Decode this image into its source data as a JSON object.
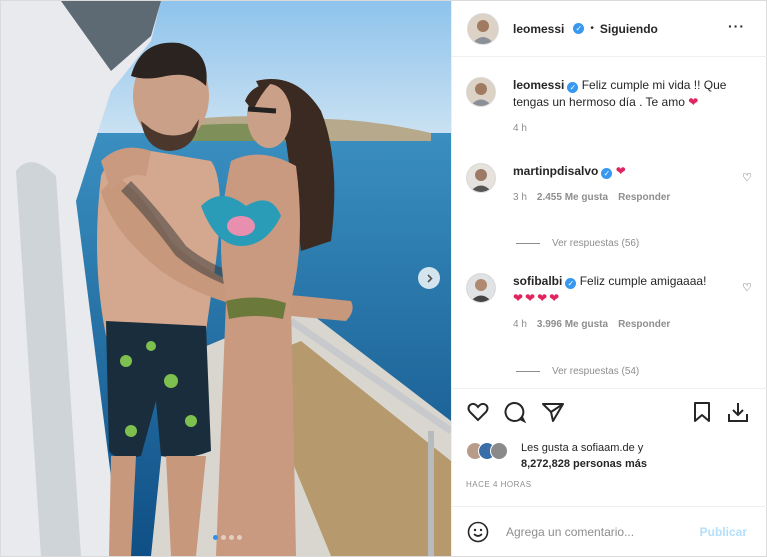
{
  "header": {
    "username": "leomessi",
    "separator": "•",
    "follow_label": "Siguiendo",
    "more_label": "···"
  },
  "caption": {
    "username": "leomessi",
    "text": "Feliz cumple mi vida !! Que tengas un hermoso día . Te amo",
    "emoji": "❤",
    "time": "4 h"
  },
  "comments": [
    {
      "username": "martinpdisalvo",
      "text": "",
      "emoji": "❤",
      "time": "3 h",
      "likes": "2.455 Me gusta",
      "reply_label": "Responder",
      "view_replies": "Ver respuestas (56)"
    },
    {
      "username": "sofibalbi",
      "text": "Feliz cumple amigaaaa!",
      "emoji": "❤❤❤❤",
      "time": "4 h",
      "likes": "3.996 Me gusta",
      "reply_label": "Responder",
      "view_replies": "Ver respuestas (54)"
    }
  ],
  "likes": {
    "line1": "Les gusta a sofiaam.de y",
    "line2": "8,272,828 personas más"
  },
  "timestamp": "HACE 4 HORAS",
  "add_comment": {
    "placeholder": "Agrega un comentario...",
    "publish_label": "Publicar"
  },
  "carousel": {
    "total": 4,
    "active": 1
  },
  "colors": {
    "verified": "#3897f0",
    "heart": "#e0245e",
    "publish_disabled": "#b2dffc"
  },
  "icons": [
    "heart-icon",
    "comment-icon",
    "share-icon",
    "bookmark-icon",
    "download-icon",
    "emoji-icon",
    "chevron-right-icon",
    "more-icon",
    "verified-icon"
  ]
}
